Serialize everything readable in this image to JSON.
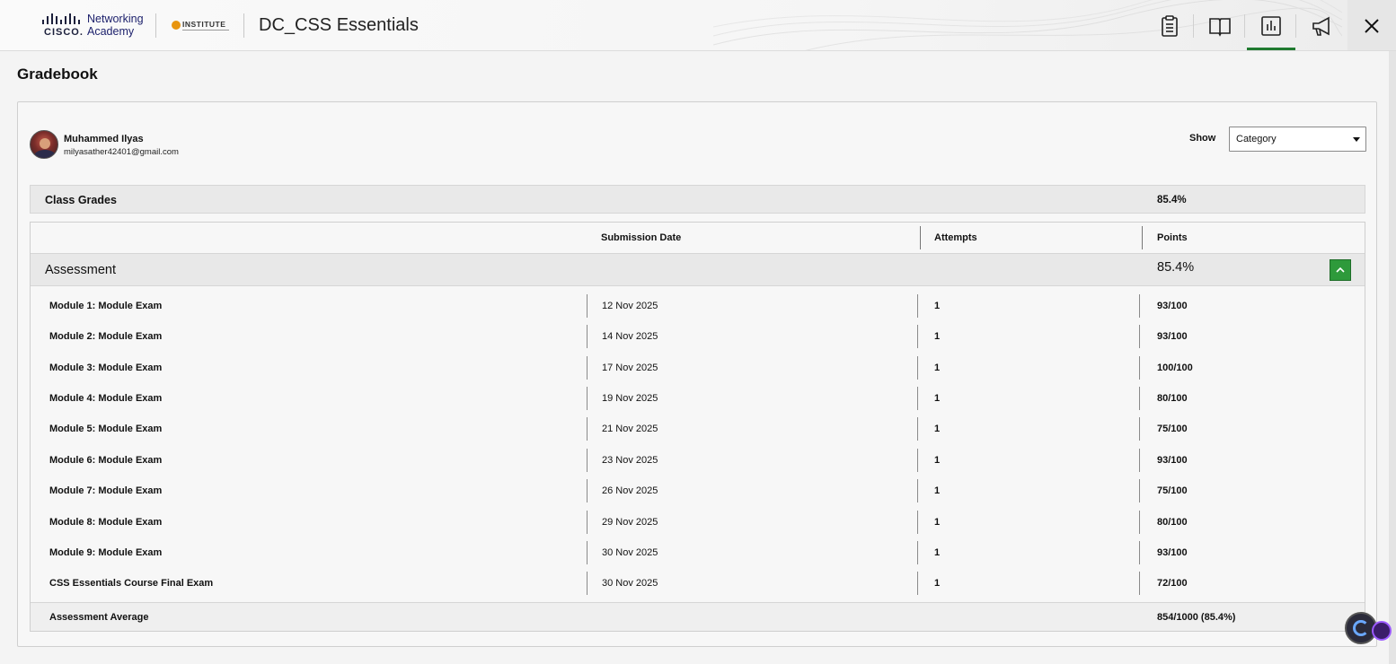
{
  "header": {
    "brand_word": "CISCO.",
    "brand_sub_line1": "Networking",
    "brand_sub_line2": "Academy",
    "partner_logo": "INSTITUTE",
    "course_title": "DC_CSS Essentials",
    "icons": [
      "assignments-icon",
      "book-icon",
      "gradebook-icon",
      "megaphone-icon",
      "close-icon"
    ],
    "active_icon": "gradebook-icon"
  },
  "page": {
    "title": "Gradebook"
  },
  "user": {
    "name": "Muhammed Ilyas",
    "email": "milyasather42401@gmail.com"
  },
  "filter": {
    "label": "Show",
    "selected": "Category"
  },
  "class_grades": {
    "label": "Class Grades",
    "value": "85.4%"
  },
  "table": {
    "headers": {
      "submission": "Submission Date",
      "attempts": "Attempts",
      "points": "Points"
    },
    "category": {
      "label": "Assessment",
      "value": "85.4%"
    },
    "rows": [
      {
        "name": "Module 1: Module Exam",
        "date": "12 Nov 2025",
        "attempts": "1",
        "points": "93/100"
      },
      {
        "name": "Module 2: Module Exam",
        "date": "14 Nov 2025",
        "attempts": "1",
        "points": "93/100"
      },
      {
        "name": "Module 3: Module Exam",
        "date": "17 Nov 2025",
        "attempts": "1",
        "points": "100/100"
      },
      {
        "name": "Module 4: Module Exam",
        "date": "19 Nov 2025",
        "attempts": "1",
        "points": "80/100"
      },
      {
        "name": "Module 5: Module Exam",
        "date": "21 Nov 2025",
        "attempts": "1",
        "points": "75/100"
      },
      {
        "name": "Module 6: Module Exam",
        "date": "23 Nov 2025",
        "attempts": "1",
        "points": "93/100"
      },
      {
        "name": "Module 7: Module Exam",
        "date": "26 Nov 2025",
        "attempts": "1",
        "points": "75/100"
      },
      {
        "name": "Module 8: Module Exam",
        "date": "29 Nov 2025",
        "attempts": "1",
        "points": "80/100"
      },
      {
        "name": "Module 9: Module Exam",
        "date": "30 Nov 2025",
        "attempts": "1",
        "points": "93/100"
      },
      {
        "name": "CSS Essentials Course Final Exam",
        "date": "30 Nov 2025",
        "attempts": "1",
        "points": "72/100"
      }
    ],
    "average": {
      "label": "Assessment Average",
      "value": "854/1000 (85.4%)"
    }
  },
  "colors": {
    "accent_green": "#2e9a3b",
    "active_underline": "#1f7a2f"
  }
}
